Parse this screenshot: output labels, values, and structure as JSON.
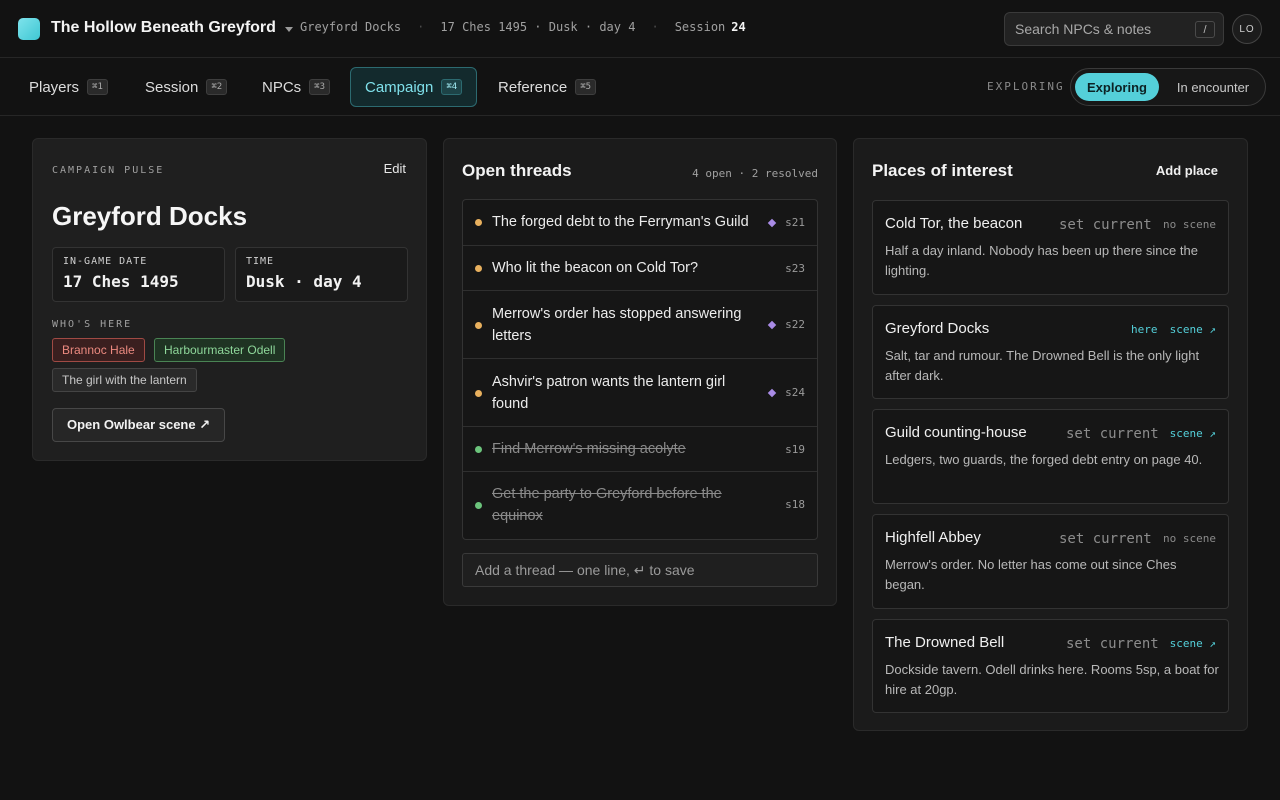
{
  "app": {
    "campaign_title": "The Hollow Beneath Greyford",
    "crumbs": {
      "location": "Greyford Docks",
      "time": "17 Ches 1495 · Dusk · day 4",
      "session_label": "Session",
      "session_number": "24"
    },
    "search_placeholder": "Search NPCs & notes",
    "search_key": "/",
    "avatar_initials": "LO"
  },
  "tabs": [
    {
      "label": "Players",
      "kbd": "⌘1"
    },
    {
      "label": "Session",
      "kbd": "⌘2"
    },
    {
      "label": "NPCs",
      "kbd": "⌘3"
    },
    {
      "label": "Campaign",
      "kbd": "⌘4"
    },
    {
      "label": "Reference",
      "kbd": "⌘5"
    }
  ],
  "mode": {
    "label": "EXPLORING",
    "options": [
      "Exploring",
      "In encounter"
    ],
    "active": "Exploring"
  },
  "pulse": {
    "eyebrow": "CAMPAIGN PULSE",
    "edit_label": "Edit",
    "title": "Greyford Docks",
    "date_label": "IN-GAME DATE",
    "date_value": "17 Ches 1495",
    "time_label": "TIME",
    "time_value": "Dusk · day 4",
    "whos_here_label": "WHO'S HERE",
    "people": [
      "Brannoc Hale",
      "Harbourmaster Odell",
      "The girl with the lantern"
    ],
    "owlbear_label": "Open Owlbear scene ↗"
  },
  "threads": {
    "title": "Open threads",
    "count": "4 open · 2 resolved",
    "items": [
      {
        "text": "The forged debt to the Ferryman's Guild",
        "ref": "s21",
        "flag": true,
        "resolved": false
      },
      {
        "text": "Who lit the beacon on Cold Tor?",
        "ref": "s23",
        "flag": false,
        "resolved": false
      },
      {
        "text": "Merrow's order has stopped answering letters",
        "ref": "s22",
        "flag": true,
        "resolved": false
      },
      {
        "text": "Ashvir's patron wants the lantern girl found",
        "ref": "s24",
        "flag": true,
        "resolved": false
      },
      {
        "text": "Find Merrow's missing acolyte",
        "ref": "s19",
        "flag": false,
        "resolved": true
      },
      {
        "text": "Get the party to Greyford before the equinox",
        "ref": "s18",
        "flag": false,
        "resolved": true
      }
    ],
    "add_placeholder": "Add a thread — one line, ↵ to save"
  },
  "places": {
    "title": "Places of interest",
    "add_label": "Add place",
    "set_current_label": "set current",
    "here_label": "here",
    "items": [
      {
        "name": "Cold Tor, the beacon",
        "desc": "Half a day inland. Nobody has been up there since the lighting.",
        "current": false,
        "scene": "no scene"
      },
      {
        "name": "Greyford Docks",
        "desc": "Salt, tar and rumour. The Drowned Bell is the only light after dark.",
        "current": true,
        "scene": "scene ↗"
      },
      {
        "name": "Guild counting-house",
        "desc": "Ledgers, two guards, the forged debt entry on page 40.",
        "current": false,
        "scene": "scene ↗"
      },
      {
        "name": "Highfell Abbey",
        "desc": "Merrow's order. No letter has come out since Ches began.",
        "current": false,
        "scene": "no scene"
      },
      {
        "name": "The Drowned Bell",
        "desc": "Dockside tavern. Odell drinks here. Rooms 5sp, a boat for hire at 20gp.",
        "current": false,
        "scene": "scene ↗"
      }
    ]
  },
  "colors": {
    "accent": "#54cfd9",
    "open_dot": "#e8b05e",
    "resolved_dot": "#6cc47c",
    "flag": "#a98be6"
  }
}
